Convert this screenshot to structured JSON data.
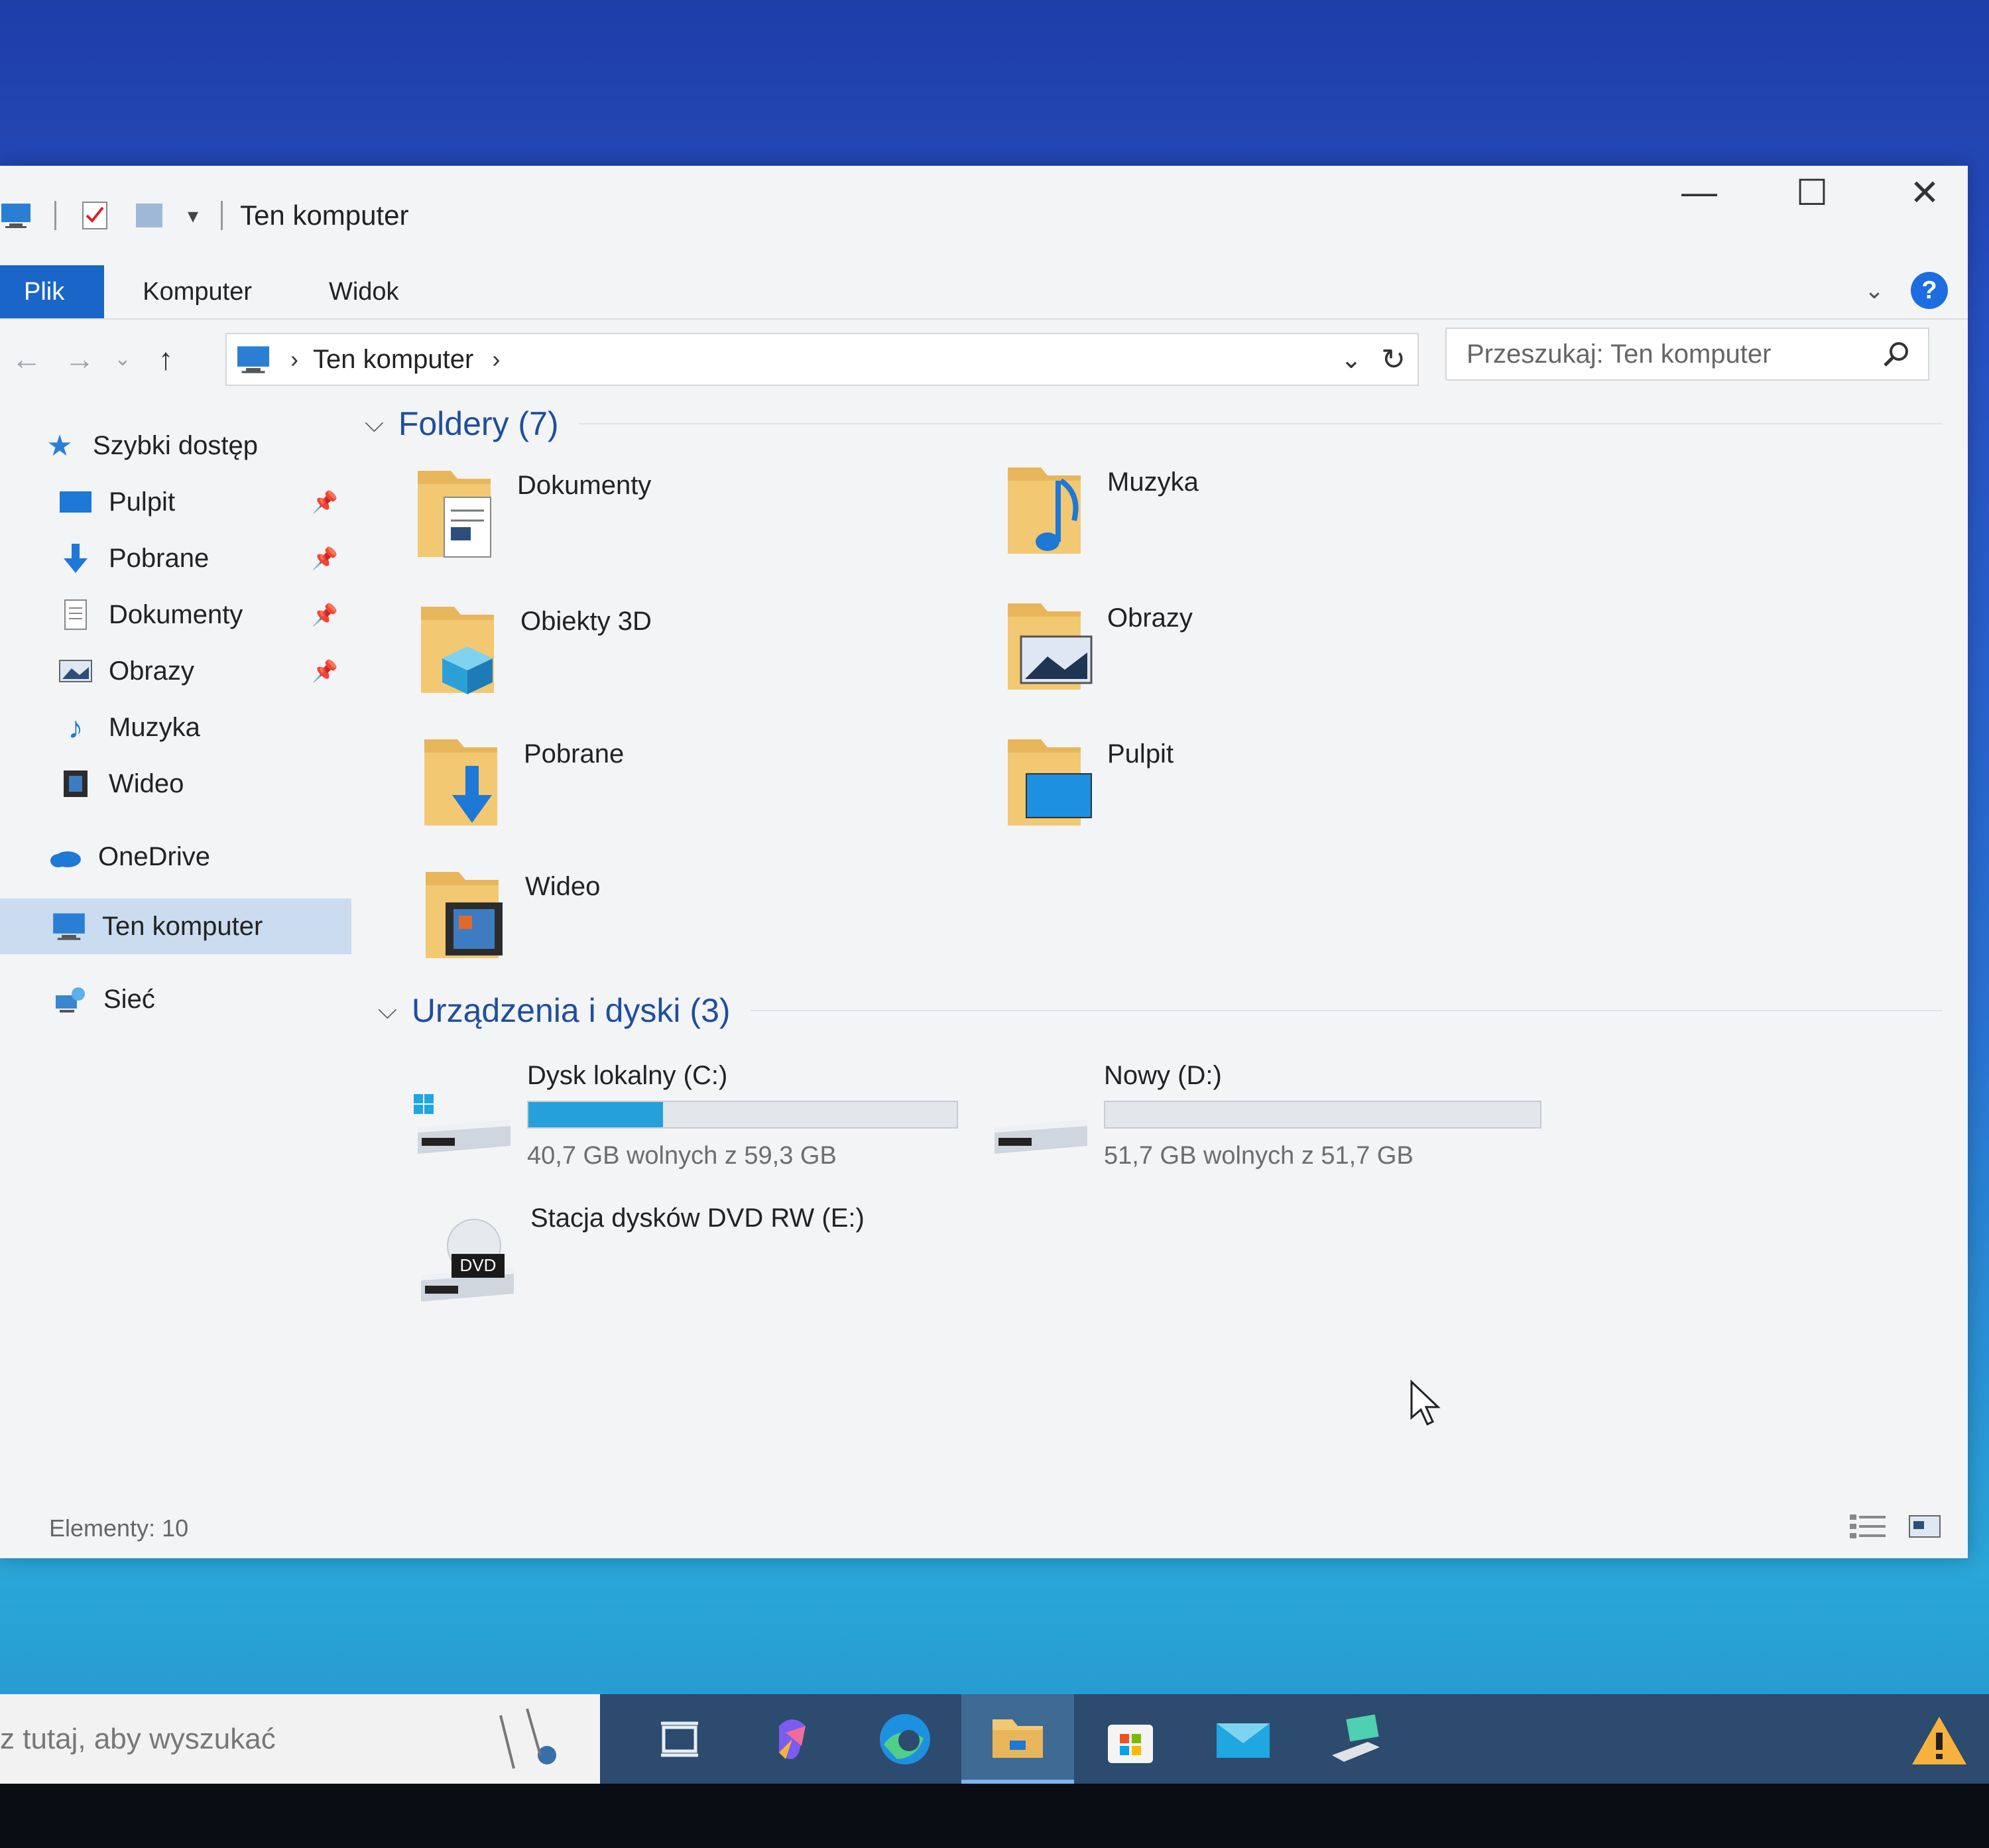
{
  "window": {
    "title": "Ten komputer",
    "controls": {
      "minimize": "—",
      "maximize": "☐",
      "close": "✕"
    }
  },
  "ribbon": {
    "tabs": [
      {
        "label": "Plik"
      },
      {
        "label": "Komputer"
      },
      {
        "label": "Widok"
      }
    ],
    "help": "?"
  },
  "navigation": {
    "back": "←",
    "forward": "→",
    "recent": "⌄",
    "up": "↑",
    "breadcrumb": "Ten komputer",
    "search_placeholder": "Przeszukaj: Ten komputer"
  },
  "sidebar": {
    "quick_access": "Szybki dostęp",
    "items": [
      {
        "label": "Pulpit",
        "pinned": true
      },
      {
        "label": "Pobrane",
        "pinned": true
      },
      {
        "label": "Dokumenty",
        "pinned": true
      },
      {
        "label": "Obrazy",
        "pinned": true
      },
      {
        "label": "Muzyka",
        "pinned": false
      },
      {
        "label": "Wideo",
        "pinned": false
      }
    ],
    "onedrive": "OneDrive",
    "this_pc": "Ten komputer",
    "network": "Sieć"
  },
  "folders": {
    "header": "Foldery (7)",
    "items": [
      {
        "name": "Dokumenty",
        "icon": "documents-folder-icon"
      },
      {
        "name": "Muzyka",
        "icon": "music-folder-icon"
      },
      {
        "name": "Obiekty 3D",
        "icon": "3d-objects-folder-icon"
      },
      {
        "name": "Obrazy",
        "icon": "pictures-folder-icon"
      },
      {
        "name": "Pobrane",
        "icon": "downloads-folder-icon"
      },
      {
        "name": "Pulpit",
        "icon": "desktop-folder-icon"
      },
      {
        "name": "Wideo",
        "icon": "videos-folder-icon"
      }
    ]
  },
  "devices": {
    "header": "Urządzenia i dyski (3)",
    "items": [
      {
        "name": "Dysk lokalny (C:)",
        "free": "40,7 GB wolnych z 59,3 GB",
        "used_fraction": 0.314
      },
      {
        "name": "Nowy (D:)",
        "free": "51,7 GB wolnych z 51,7 GB",
        "used_fraction": 0.0
      },
      {
        "name": "Stacja dysków DVD RW (E:)"
      }
    ],
    "dvd_label": "DVD"
  },
  "status": {
    "items": "Elementy: 10"
  },
  "taskbar": {
    "search_placeholder": "z tutaj, aby wyszukać",
    "apps": [
      "task-view-icon",
      "copilot-icon",
      "edge-icon",
      "file-explorer-icon",
      "store-icon",
      "mail-icon",
      "network-app-icon"
    ]
  },
  "colors": {
    "accent": "#1a66c8",
    "drive_fill": "#26a0da",
    "folder": "#e8b65a"
  }
}
